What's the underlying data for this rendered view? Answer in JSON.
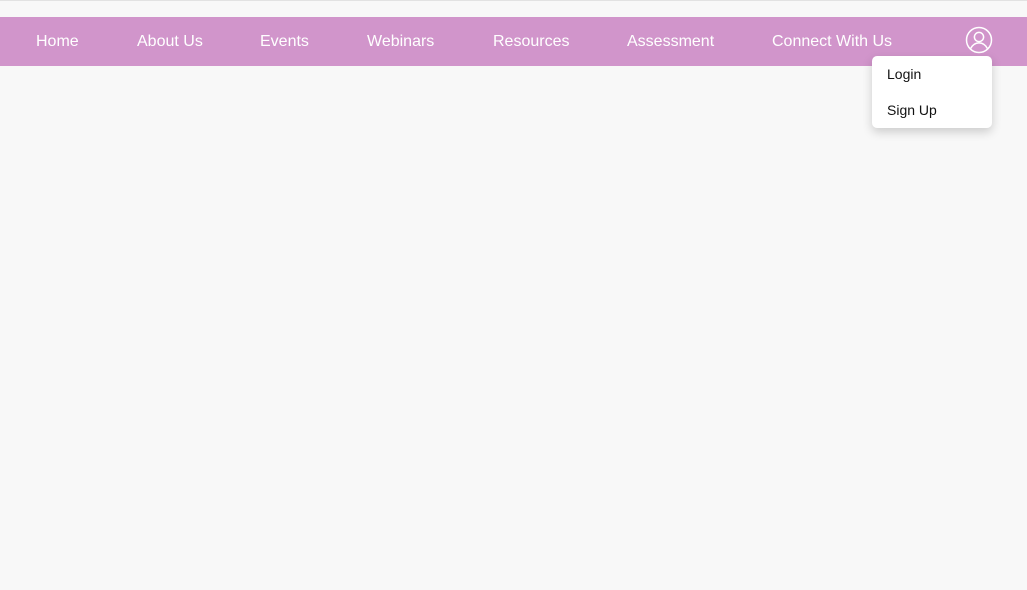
{
  "nav": {
    "items": [
      {
        "label": "Home"
      },
      {
        "label": "About Us"
      },
      {
        "label": "Events"
      },
      {
        "label": "Webinars"
      },
      {
        "label": "Resources"
      },
      {
        "label": "Assessment"
      },
      {
        "label": "Connect With Us"
      }
    ],
    "user_icon": "user-circle-icon"
  },
  "user_menu": {
    "login_label": "Login",
    "signup_label": "Sign Up"
  },
  "colors": {
    "nav_background": "#d195cb",
    "nav_text": "#ffffff",
    "page_background": "#f8f8f8"
  }
}
